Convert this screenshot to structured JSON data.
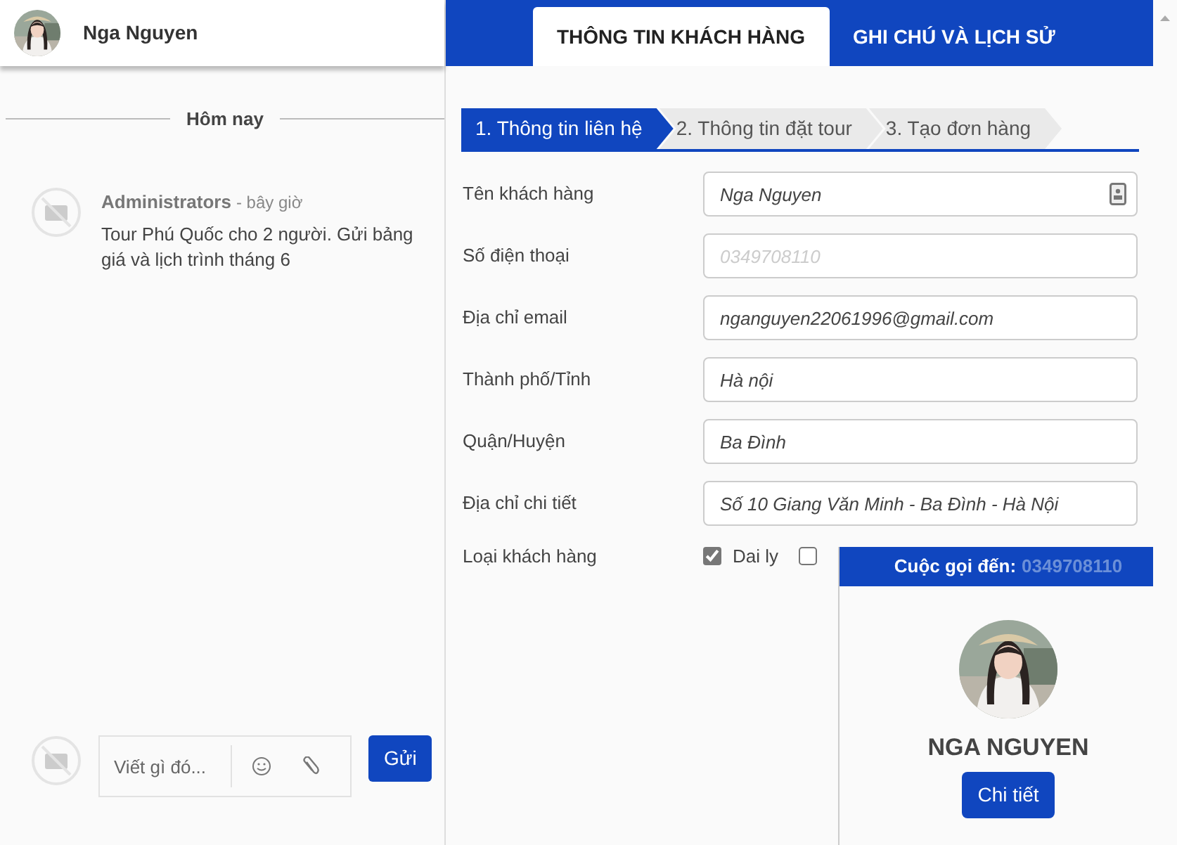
{
  "chat": {
    "contact": {
      "name": "Nga Nguyen"
    },
    "divider": "Hôm nay",
    "messages": [
      {
        "author": "Administrators",
        "time": "- bây giờ",
        "text": "Tour Phú Quốc cho 2 người. Gửi bảng giá và lịch trình tháng 6"
      }
    ],
    "composer": {
      "placeholder": "Viết gì đó...",
      "send": "Gửi"
    }
  },
  "tabs": [
    {
      "label": "THÔNG TIN KHÁCH HÀNG",
      "selected": true
    },
    {
      "label": "GHI CHÚ VÀ LỊCH SỬ",
      "selected": false
    }
  ],
  "steps": [
    {
      "label": "1. Thông tin liên hệ",
      "selected": true
    },
    {
      "label": "2. Thông tin đặt tour",
      "selected": false
    },
    {
      "label": "3. Tạo đơn hàng",
      "selected": false
    }
  ],
  "form": [
    {
      "kind": "text",
      "label": "Tên khách hàng",
      "value": "Nga Nguyen",
      "contact_icon": true
    },
    {
      "kind": "text",
      "label": "Số điện thoại",
      "placeholder": "0349708110"
    },
    {
      "kind": "text",
      "label": "Địa chỉ email",
      "value": "nganguyen22061996@gmail.com"
    },
    {
      "kind": "text",
      "label": "Thành phố/Tỉnh",
      "value": "Hà nội"
    },
    {
      "kind": "text",
      "label": "Quận/Huyện",
      "value": "Ba Đình"
    },
    {
      "kind": "text",
      "label": "Địa chỉ chi tiết",
      "value": "Số 10 Giang Văn Minh - Ba Đình - Hà Nội"
    },
    {
      "kind": "checks",
      "label": "Loại khách hàng",
      "options": [
        {
          "label": "Dai ly",
          "checked": true
        },
        {
          "checked": false
        }
      ]
    }
  ],
  "incoming_call": {
    "title": "Cuộc gọi đến:",
    "number": "0349708110",
    "name": "NGA NGUYEN",
    "button": "Chi tiết"
  }
}
